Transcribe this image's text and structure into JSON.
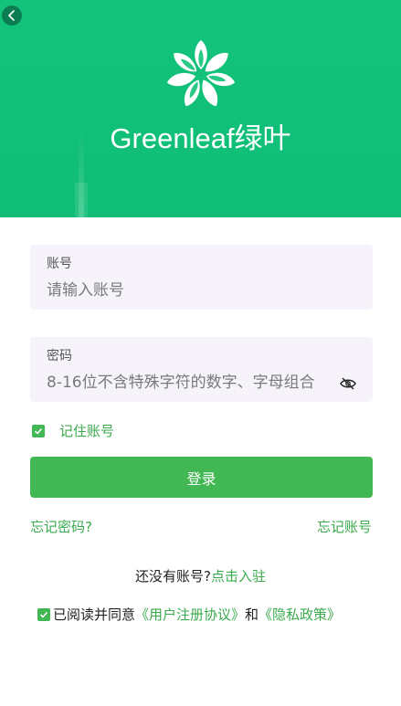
{
  "header": {
    "brand_text": "Greenleaf绿叶",
    "back_icon": "chevron-left-icon",
    "colors": {
      "background": "#13c37b",
      "back_button": "#0b7d52"
    }
  },
  "form": {
    "username": {
      "label": "账号",
      "placeholder": "请输入账号",
      "value": ""
    },
    "password": {
      "label": "密码",
      "placeholder": "8-16位不含特殊字符的数字、字母组合",
      "value": "",
      "toggle_icon": "eye-off-icon"
    },
    "remember": {
      "label": "记住账号",
      "checked": true
    },
    "login_label": "登录",
    "forgot_password": "忘记密码?",
    "forgot_account": "忘记账号"
  },
  "register": {
    "prompt": "还没有账号?",
    "link": "点击入驻"
  },
  "agreement": {
    "checked": true,
    "prefix": "已阅读并同意",
    "user_agreement": "《用户注册协议》",
    "conjunction": "和",
    "privacy_policy": "《隐私政策》"
  },
  "colors": {
    "accent": "#41b853",
    "link": "#3aaa4e",
    "field_bg": "#f7f3fa"
  }
}
